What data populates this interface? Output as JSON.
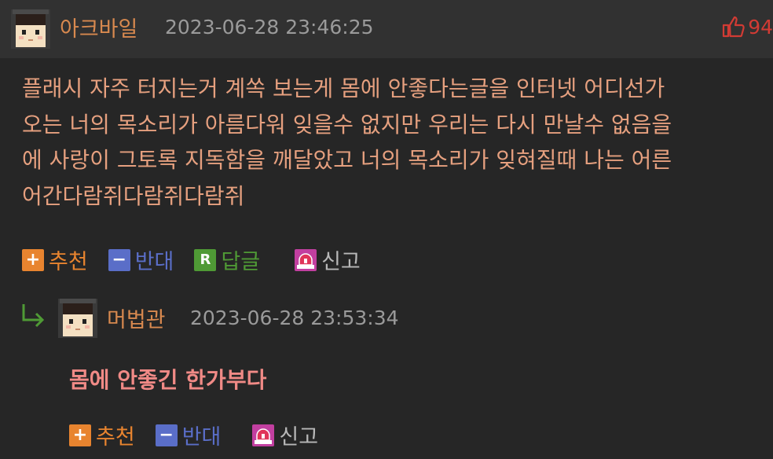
{
  "post": {
    "nickname": "아크바일",
    "date": "2023-06-28 23:46:25",
    "like_count": "94",
    "lines": [
      "플래시 자주 터지는거 계쏙 보는게 몸에 안좋다는글을 인터넷 어디선가",
      "오는 너의 목소리가 아름다워 잊을수 없지만 우리는 다시 만날수 없음을",
      "에 사랑이 그토록 지독함을 깨달았고 너의 목소리가 잊혀질때 나는 어른",
      "어간다람쥐다람쥐다람쥐"
    ],
    "actions": {
      "recommend": "추천",
      "oppose": "반대",
      "reply": "답글",
      "report": "신고"
    },
    "icons": {
      "like": "thumbs-up-icon",
      "recommend": "plus-icon",
      "oppose": "minus-icon",
      "reply": "r-icon",
      "report": "siren-icon"
    }
  },
  "reply": {
    "nickname": "머법관",
    "date": "2023-06-28 23:53:34",
    "text": "몸에 안좋긴 한가부다",
    "actions": {
      "recommend": "추천",
      "oppose": "반대",
      "report": "신고"
    },
    "icons": {
      "reply_arrow": "reply-arrow-icon"
    }
  },
  "colors": {
    "background": "#262626",
    "header": "#313131",
    "nickname": "#d8894f",
    "body_text": "#e6a07f",
    "reply_text": "#f08a86",
    "recommend": "#e8842f",
    "oppose": "#5a6ec8",
    "reply": "#4f9a35",
    "report": "#c23fa0",
    "like": "#d23b34"
  }
}
